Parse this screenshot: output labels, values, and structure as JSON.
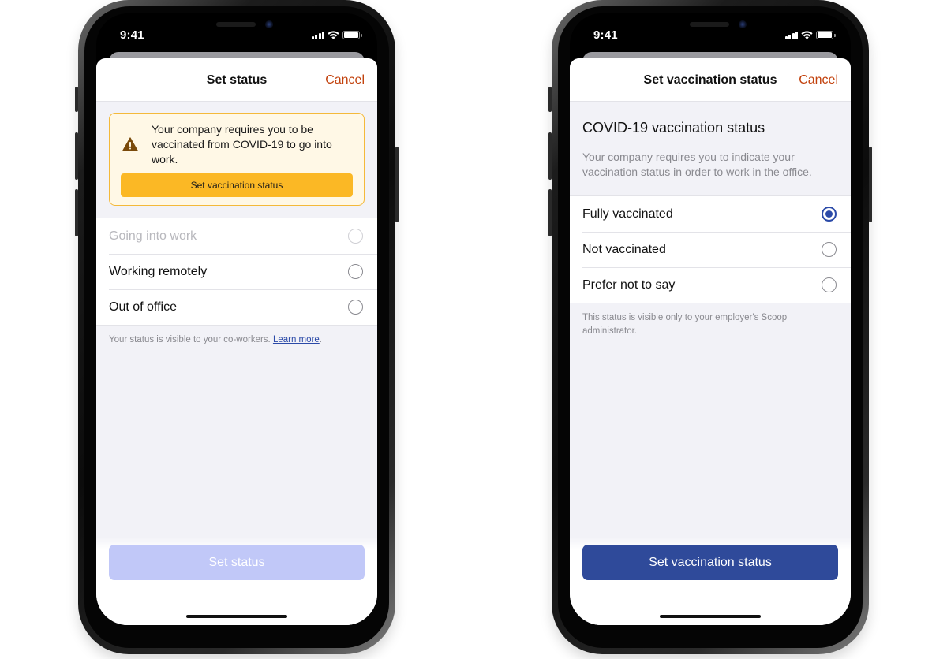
{
  "status_bar": {
    "time": "9:41"
  },
  "left": {
    "nav": {
      "title": "Set status",
      "cancel": "Cancel"
    },
    "alert": {
      "icon": "warning-triangle-icon",
      "message": "Your company requires you to be vaccinated from COVID-19 to go into work.",
      "button": "Set vaccination status"
    },
    "options": [
      {
        "label": "Going into work",
        "disabled": true
      },
      {
        "label": "Working remotely",
        "disabled": false
      },
      {
        "label": "Out of office",
        "disabled": false
      }
    ],
    "footnote": {
      "text": "Your status is visible to your co-workers. ",
      "link": "Learn more",
      "suffix": "."
    },
    "primary_button": "Set status"
  },
  "right": {
    "nav": {
      "title": "Set vaccination status",
      "cancel": "Cancel"
    },
    "heading": "COVID-19 vaccination status",
    "subtext": "Your company requires you to indicate your vaccination status in order to work in the office.",
    "options": [
      {
        "label": "Fully vaccinated",
        "selected": true
      },
      {
        "label": "Not vaccinated",
        "selected": false
      },
      {
        "label": "Prefer not to say",
        "selected": false
      }
    ],
    "footnote": "This status is visible only to your employer's Scoop administrator.",
    "primary_button": "Set vaccination status"
  },
  "colors": {
    "accent": "#2f4a9a",
    "cancel": "#c2410c",
    "alert_bg": "#fff8e6",
    "alert_button": "#fbb825",
    "disabled_button": "#c1c8f8"
  }
}
